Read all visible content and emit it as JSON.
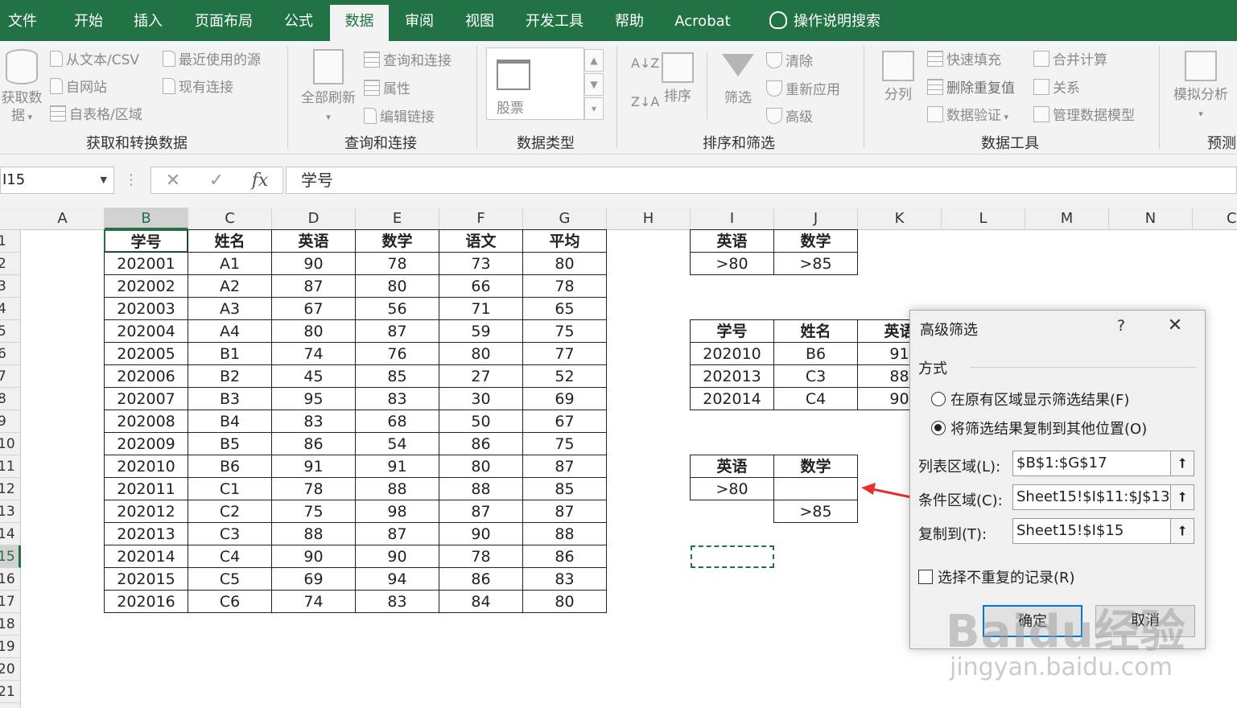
{
  "tabs": [
    {
      "label": "文件",
      "active": false
    },
    {
      "label": "开始",
      "active": false
    },
    {
      "label": "插入",
      "active": false
    },
    {
      "label": "页面布局",
      "active": false
    },
    {
      "label": "公式",
      "active": false
    },
    {
      "label": "数据",
      "active": true
    },
    {
      "label": "审阅",
      "active": false
    },
    {
      "label": "视图",
      "active": false
    },
    {
      "label": "开发工具",
      "active": false
    },
    {
      "label": "帮助",
      "active": false
    },
    {
      "label": "Acrobat",
      "active": false
    }
  ],
  "search": {
    "label": "操作说明搜索",
    "icon": "lightbulb-icon"
  },
  "ribbon": {
    "get_data": "获取数\n据",
    "from_text_csv": "从文本/CSV",
    "from_web": "自网站",
    "from_table": "自表格/区域",
    "recent_sources": "最近使用的源",
    "existing_connections": "现有连接",
    "group_get_transform": "获取和转换数据",
    "refresh_all": "全部刷新",
    "queries_connections": "查询和连接",
    "properties": "属性",
    "edit_links": "编辑链接",
    "group_queries": "查询和连接",
    "stocks": "股票",
    "group_datatypes": "数据类型",
    "sort": "排序",
    "filter": "筛选",
    "clear": "清除",
    "reapply": "重新应用",
    "advanced": "高级",
    "group_sort_filter": "排序和筛选",
    "text_to_columns": "分列",
    "flash_fill": "快速填充",
    "remove_duplicates": "删除重复值",
    "data_validation": "数据验证",
    "consolidate": "合并计算",
    "relationships": "关系",
    "manage_model": "管理数据模型",
    "group_datatools": "数据工具",
    "what_if": "模拟分析",
    "group_forecast": "预测"
  },
  "formula_bar": {
    "name_box": "I15",
    "formula": "学号"
  },
  "columns": [
    "A",
    "B",
    "C",
    "D",
    "E",
    "F",
    "G",
    "H",
    "I",
    "J",
    "K",
    "L",
    "M",
    "N",
    "C"
  ],
  "rows": [
    "1",
    "2",
    "3",
    "4",
    "5",
    "6",
    "7",
    "8",
    "9",
    "10",
    "11",
    "12",
    "13",
    "14",
    "15",
    "16",
    "17",
    "18",
    "19",
    "20",
    "21"
  ],
  "main_table": {
    "headers": [
      "学号",
      "姓名",
      "英语",
      "数学",
      "语文",
      "平均"
    ],
    "rows": [
      [
        "202001",
        "A1",
        "90",
        "78",
        "73",
        "80"
      ],
      [
        "202002",
        "A2",
        "87",
        "80",
        "66",
        "78"
      ],
      [
        "202003",
        "A3",
        "67",
        "56",
        "71",
        "65"
      ],
      [
        "202004",
        "A4",
        "80",
        "87",
        "59",
        "75"
      ],
      [
        "202005",
        "B1",
        "74",
        "76",
        "80",
        "77"
      ],
      [
        "202006",
        "B2",
        "45",
        "85",
        "27",
        "52"
      ],
      [
        "202007",
        "B3",
        "95",
        "83",
        "30",
        "69"
      ],
      [
        "202008",
        "B4",
        "83",
        "68",
        "50",
        "67"
      ],
      [
        "202009",
        "B5",
        "86",
        "54",
        "86",
        "75"
      ],
      [
        "202010",
        "B6",
        "91",
        "91",
        "80",
        "87"
      ],
      [
        "202011",
        "C1",
        "78",
        "88",
        "88",
        "85"
      ],
      [
        "202012",
        "C2",
        "75",
        "98",
        "87",
        "87"
      ],
      [
        "202013",
        "C3",
        "88",
        "87",
        "90",
        "88"
      ],
      [
        "202014",
        "C4",
        "90",
        "90",
        "78",
        "86"
      ],
      [
        "202015",
        "C5",
        "69",
        "94",
        "86",
        "83"
      ],
      [
        "202016",
        "C6",
        "74",
        "83",
        "84",
        "80"
      ]
    ]
  },
  "criteria_and": {
    "headers": [
      "英语",
      "数学"
    ],
    "values": [
      ">80",
      ">85"
    ]
  },
  "result_table": {
    "headers": [
      "学号",
      "姓名",
      "英语"
    ],
    "rows": [
      [
        "202010",
        "B6",
        "91"
      ],
      [
        "202013",
        "C3",
        "88"
      ],
      [
        "202014",
        "C4",
        "90"
      ]
    ]
  },
  "criteria_or": {
    "headers": [
      "英语",
      "数学"
    ],
    "row1": [
      ">80",
      ""
    ],
    "row2": [
      "",
      ">85"
    ]
  },
  "dialog": {
    "title": "高级筛选",
    "help": "?",
    "close": "✕",
    "mode_label": "方式",
    "option_in_place": "在原有区域显示筛选结果(F)",
    "option_copy": "将筛选结果复制到其他位置(O)",
    "list_range_label": "列表区域(L):",
    "list_range_value": "$B$1:$G$17",
    "criteria_range_label": "条件区域(C):",
    "criteria_range_value": "Sheet15!$I$11:$J$13",
    "copy_to_label": "复制到(T):",
    "copy_to_value": "Sheet15!$I$15",
    "unique_label": "选择不重复的记录(R)",
    "ok": "确定",
    "cancel": "取消"
  },
  "watermark": {
    "line1": "Baidu经验",
    "line2": "jingyan.baidu.com"
  },
  "colors": {
    "accent": "#217346",
    "arrow": "#e8312c"
  }
}
